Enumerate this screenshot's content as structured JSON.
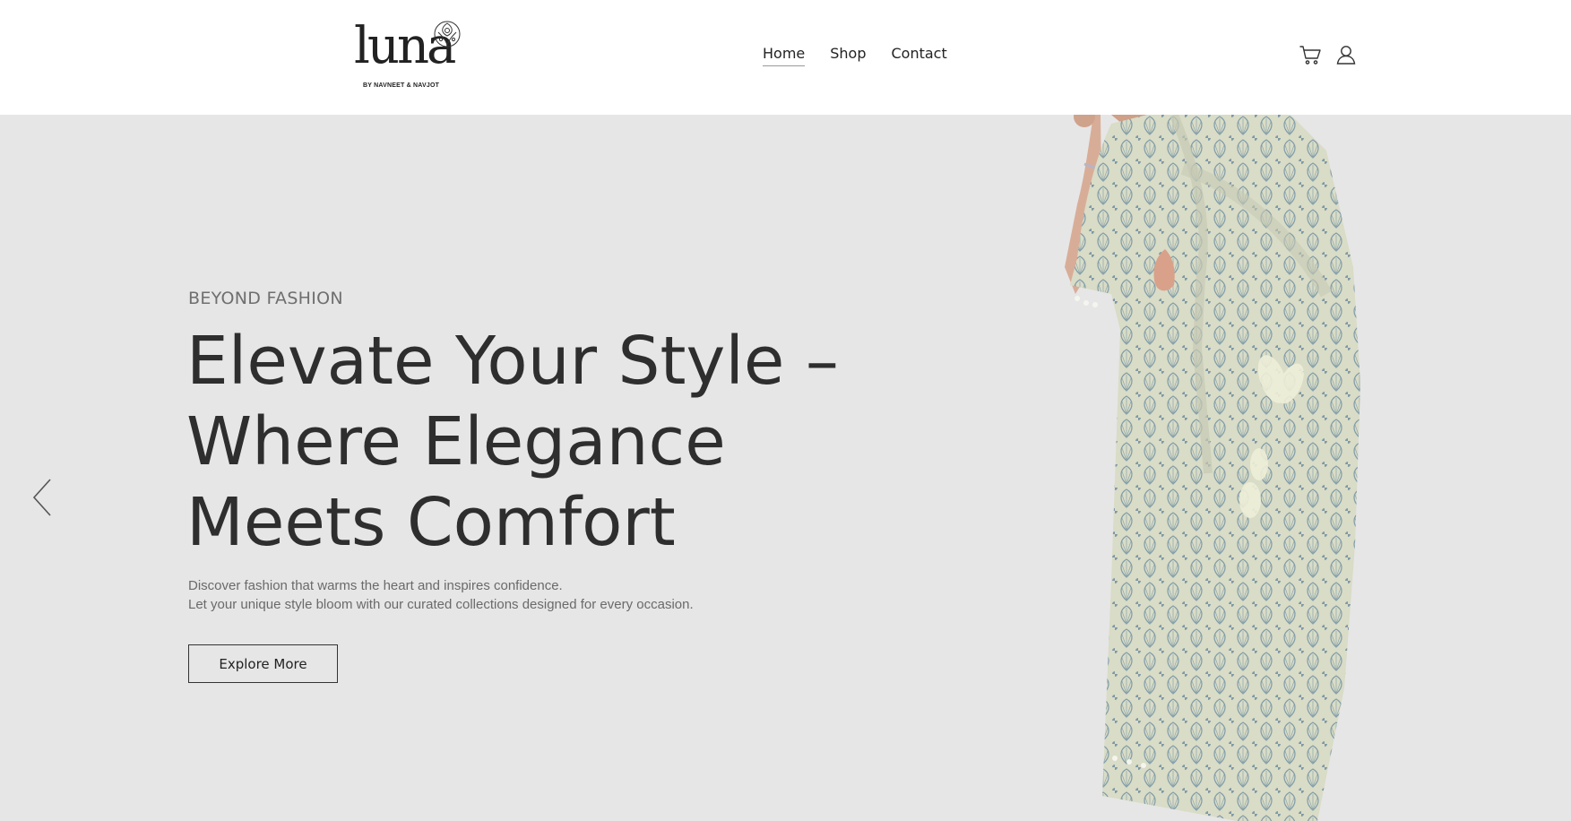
{
  "brand": {
    "logo_text": "luna",
    "logo_subtitle": "BY NAVNEET & NAVJOT"
  },
  "nav": {
    "items": [
      {
        "label": "Home",
        "active": true
      },
      {
        "label": "Shop",
        "active": false
      },
      {
        "label": "Contact",
        "active": false
      }
    ]
  },
  "header_icons": {
    "cart": "cart-icon",
    "user": "user-icon"
  },
  "hero": {
    "eyebrow": "BEYOND FASHION",
    "headline_lines": [
      "Elevate Your Style –",
      "Where Elegance",
      "Meets Comfort"
    ],
    "description_lines": [
      "Discover fashion that warms the heart and inspires confidence.",
      "Let your unique style bloom with our curated collections designed for every occasion."
    ],
    "cta_label": "Explore More",
    "prev_icon": "chevron-left-icon",
    "image": "model-in-printed-kurta-with-dupatta"
  },
  "colors": {
    "hero_background": "#e6e6e6",
    "text_dark": "#2e2e2e",
    "text_muted": "#6a6a6a"
  }
}
